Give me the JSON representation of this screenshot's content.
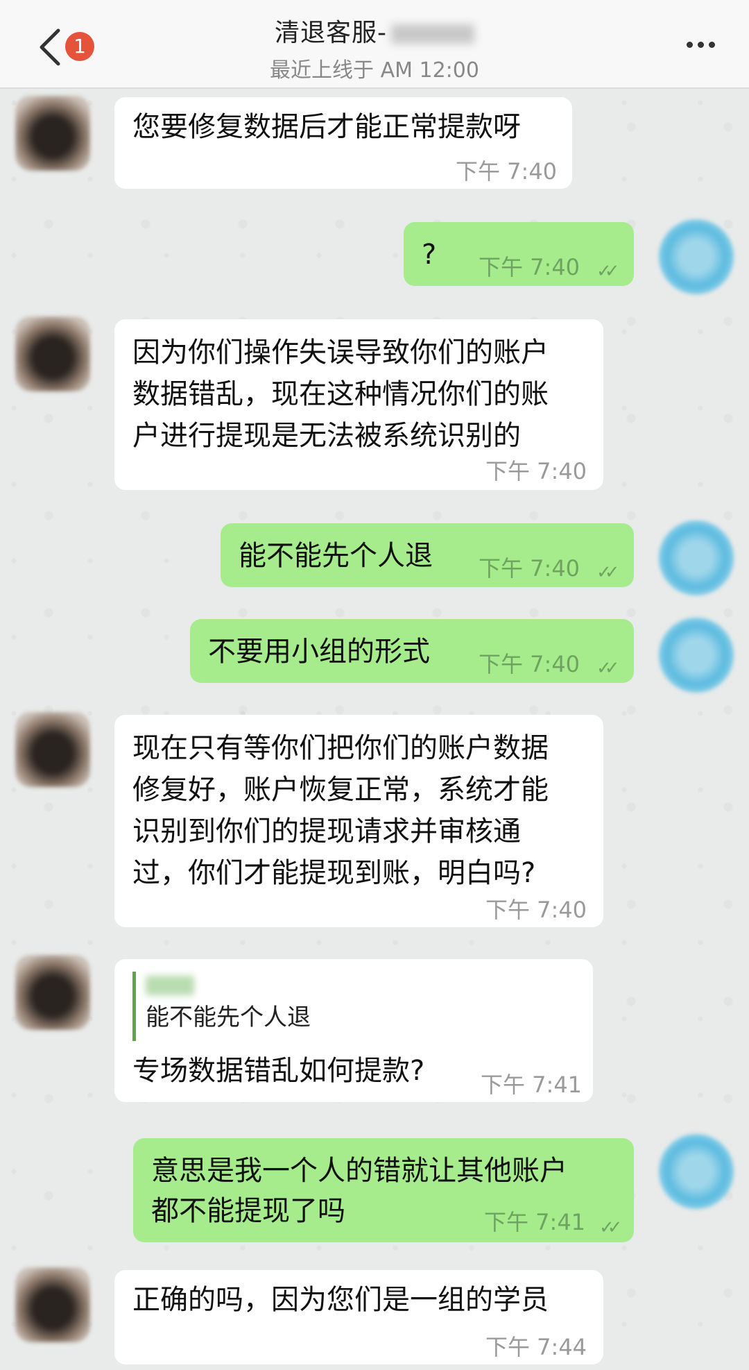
{
  "header": {
    "back_badge": "1",
    "title": "清退客服-",
    "last_seen": "最近上线于 AM 12:00"
  },
  "messages": [
    {
      "side": "in",
      "text": "您要修复数据后才能正常提款呀",
      "time": "下午  7:40"
    },
    {
      "side": "out",
      "text": "?",
      "time": "下午  7:40"
    },
    {
      "side": "in",
      "text": "因为你们操作失误导致你们的账户\n数据错乱，现在这种情况你们的账\n户进行提现是无法被系统识别的",
      "time": "下午  7:40"
    },
    {
      "side": "out",
      "text": "能不能先个人退",
      "time": "下午  7:40"
    },
    {
      "side": "out",
      "text": "不要用小组的形式",
      "time": "下午  7:40"
    },
    {
      "side": "in",
      "text": "现在只有等你们把你们的账户数据\n修复好，账户恢复正常，系统才能\n识别到你们的提现请求并审核通\n过，你们才能提现到账，明白吗?",
      "time": "下午  7:40"
    },
    {
      "side": "in",
      "quote": "能不能先个人退",
      "text": "专场数据错乱如何提款?",
      "time": "下午  7:41"
    },
    {
      "side": "out",
      "text": "意思是我一个人的错就让其他账户\n都不能提现了吗",
      "time": "下午  7:41"
    },
    {
      "side": "in",
      "text": "正确的吗，因为您们是一组的学员",
      "time": "下午  7:44"
    }
  ],
  "icons": {
    "back": "chevron-left-icon",
    "menu": "more-horizontal-icon",
    "read": "double-check-icon"
  }
}
